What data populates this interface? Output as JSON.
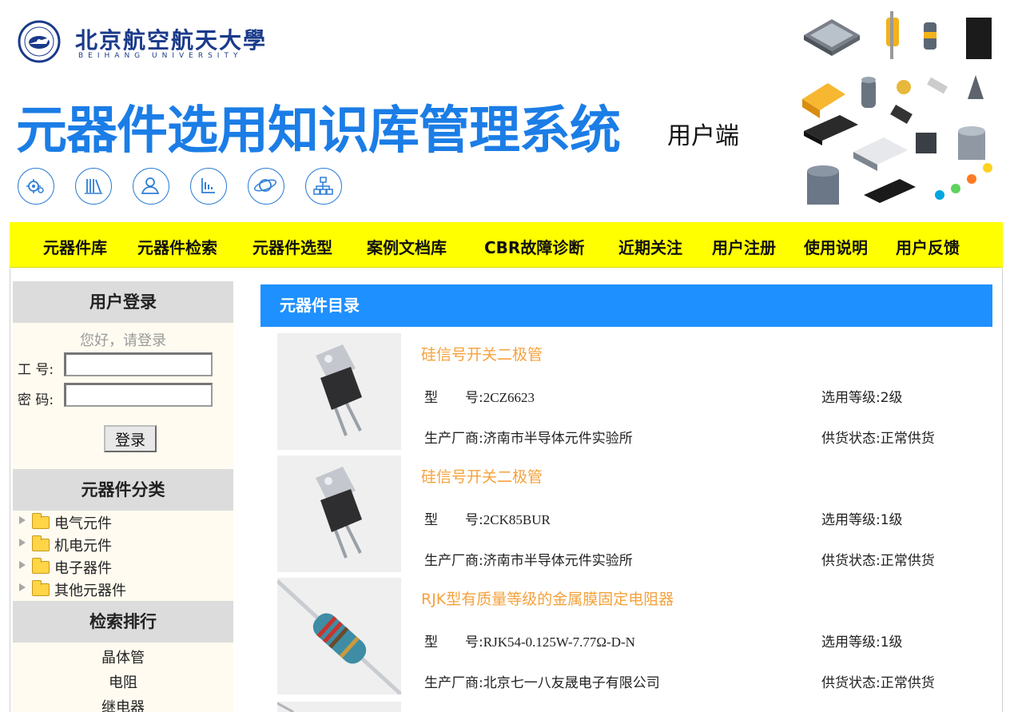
{
  "header": {
    "logo_cn": "北京航空航天大學",
    "logo_en": "BEIHANG UNIVERSITY",
    "title": "元器件选用知识库管理系统",
    "subtitle": "用户端",
    "accent_color": "#1b7de6",
    "round_icons": [
      "gear-icon",
      "books-icon",
      "user-icon",
      "chart-icon",
      "planet-icon",
      "sitemap-icon"
    ]
  },
  "nav": {
    "background": "#ffff00",
    "items": [
      "元器件库",
      "元器件检索",
      "元器件选型",
      "案例文档库",
      "CBR故障诊断",
      "近期关注",
      "用户注册",
      "使用说明",
      "用户反馈"
    ]
  },
  "sidebar": {
    "login_title": "用户登录",
    "greeting": "您好，请登录",
    "id_label": "工 号:",
    "id_value": "",
    "password_label": "密 码:",
    "password_value": "",
    "login_button": "登录",
    "category_title": "元器件分类",
    "categories": [
      "电气元件",
      "机电元件",
      "电子器件",
      "其他元器件"
    ],
    "ranking_title": "检索排行",
    "ranking": [
      "晶体管",
      "电阻",
      "继电器"
    ]
  },
  "main": {
    "heading": "元器件目录",
    "header_color": "#1e90ff",
    "title_color": "#f5a23c",
    "model_label": "型　　号:",
    "maker_label": "生产厂商:",
    "grade_label": "选用等级:",
    "supply_label": "供货状态:",
    "items": [
      {
        "title": "硅信号开关二极管",
        "model": "2CZ6623",
        "maker": "济南市半导体元件实验所",
        "grade": "2级",
        "supply": "正常供货",
        "image": "to220-diode"
      },
      {
        "title": "硅信号开关二极管",
        "model": "2CK85BUR",
        "maker": "济南市半导体元件实验所",
        "grade": "1级",
        "supply": "正常供货",
        "image": "to220-diode"
      },
      {
        "title": "RJK型有质量等级的金属膜固定电阻器",
        "model": "RJK54-0.125W-7.77Ω-D-N",
        "maker": "北京七一八友晟电子有限公司",
        "grade": "1级",
        "supply": "正常供货",
        "image": "resistor"
      }
    ]
  }
}
